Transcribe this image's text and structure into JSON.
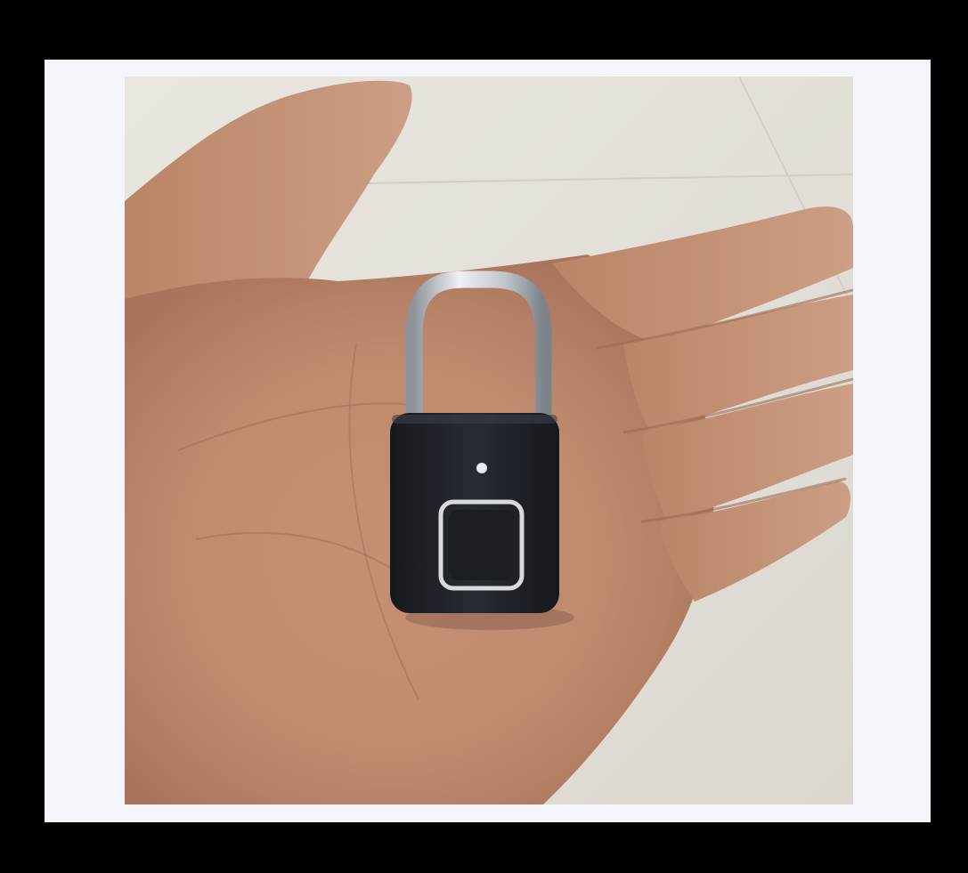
{
  "image": {
    "subject": "hand-holding-fingerprint-padlock",
    "colors": {
      "outer_frame": "#000000",
      "mat": "#f4f5fa",
      "floor": "#e7e4de",
      "skin": "#c99a80",
      "lock_body": "#1f2329",
      "shackle": "#c9cdd2",
      "sensor_ring": "#d8dade",
      "led": "#e9ecef"
    }
  }
}
